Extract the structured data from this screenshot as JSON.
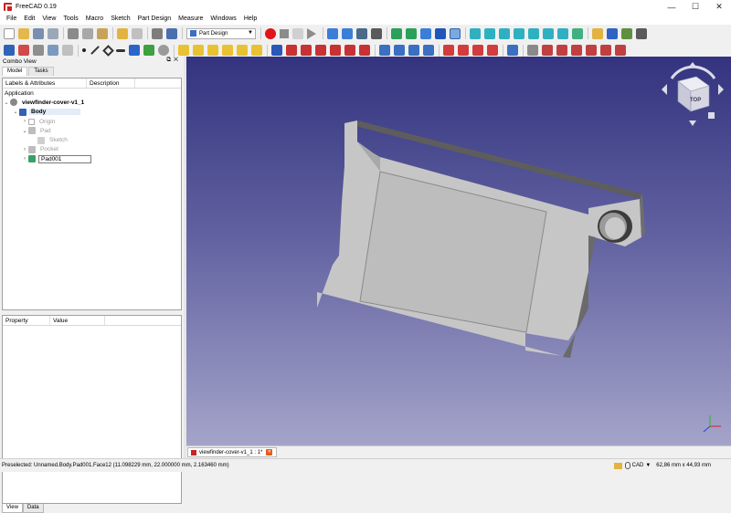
{
  "window": {
    "title": "FreeCAD 0.19",
    "minimize_icon": "minimize-icon",
    "maximize_icon": "maximize-icon",
    "close_icon": "close-icon"
  },
  "menubar": {
    "items": [
      "File",
      "Edit",
      "View",
      "Tools",
      "Macro",
      "Sketch",
      "Part Design",
      "Measure",
      "Windows",
      "Help"
    ]
  },
  "toolbar": {
    "workbench_selector": "Part Design",
    "workbench_options_visible": [
      "Part Design"
    ]
  },
  "combo_view": {
    "title": "Combo View",
    "tabs": [
      "Model",
      "Tasks"
    ],
    "active_tab": "Model",
    "tree": {
      "columns": [
        "Labels & Attributes",
        "Description"
      ],
      "section": "Application",
      "items": [
        {
          "label": "viewfinder-cover-v1_1",
          "icon": "document-icon",
          "bold": true
        },
        {
          "label": "Body",
          "icon": "body-icon",
          "bold": true
        },
        {
          "label": "Origin",
          "icon": "origin-icon",
          "dim": true
        },
        {
          "label": "Pad",
          "icon": "pad-icon",
          "dim": true
        },
        {
          "label": "Sketch",
          "icon": "sketch-icon",
          "dim": true
        },
        {
          "label": "Pocket",
          "icon": "pocket-icon",
          "dim": true
        },
        {
          "label": "Pad001",
          "icon": "pad-icon"
        }
      ]
    },
    "property_view": {
      "columns": [
        "Property",
        "Value"
      ]
    },
    "bottom_tabs": [
      "View",
      "Data"
    ],
    "active_bottom_tab": "View"
  },
  "viewport": {
    "background_top": "#33337f",
    "background_bottom": "#a4a4ca",
    "navcube_face_label": "TOP",
    "part_color": "#c4c4c4"
  },
  "document_tab": {
    "label": "viewfinder-cover-v1_1 : 1*"
  },
  "statusbar": {
    "message": "Preselected: Unnamed.Body.Pad001.Face12 (11.098229 mm, 22.000000 mm, 2.163460 mm)",
    "navigation_style": "CAD",
    "dimensions": "62,86 mm x 44,93 mm"
  }
}
